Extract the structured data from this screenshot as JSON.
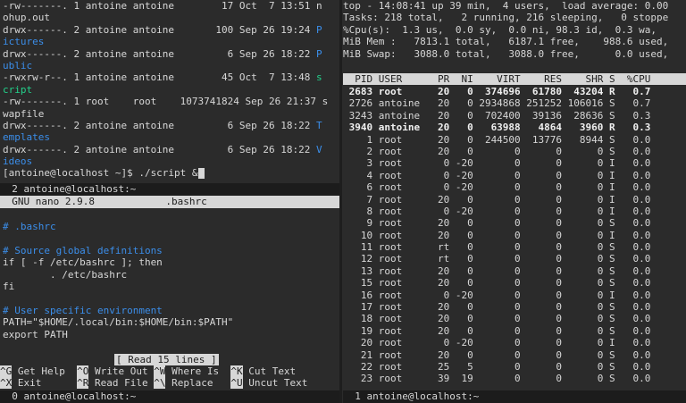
{
  "left_top_terminal": {
    "lines": [
      {
        "text": "-rw-------. 1 antoine antoine        17 Oct  7 13:51 ",
        "tail": "n",
        "tail_color": "dim"
      },
      {
        "text": "ohup.out",
        "tail": "",
        "tail_color": "dim"
      },
      {
        "text": "drwx------. 2 antoine antoine       100 Sep 26 19:24 ",
        "tail": "P",
        "tail_color": "blue"
      },
      {
        "text": "",
        "tail": "ictures",
        "tail_color": "blue"
      },
      {
        "text": "drwx------. 2 antoine antoine         6 Sep 26 18:22 ",
        "tail": "P",
        "tail_color": "blue"
      },
      {
        "text": "",
        "tail": "ublic",
        "tail_color": "blue"
      },
      {
        "text": "-rwxrw-r--. 1 antoine antoine        45 Oct  7 13:48 ",
        "tail": "s",
        "tail_color": "green"
      },
      {
        "text": "",
        "tail": "cript",
        "tail_color": "green"
      },
      {
        "text": "-rw-------. 1 root    root    1073741824 Sep 26 21:37 ",
        "tail": "s",
        "tail_color": "dim"
      },
      {
        "text": "wapfile",
        "tail": "",
        "tail_color": "dim"
      },
      {
        "text": "drwx------. 2 antoine antoine         6 Sep 26 18:22 ",
        "tail": "T",
        "tail_color": "blue"
      },
      {
        "text": "",
        "tail": "emplates",
        "tail_color": "blue"
      },
      {
        "text": "drwx------. 2 antoine antoine         6 Sep 26 18:22 ",
        "tail": "V",
        "tail_color": "blue"
      },
      {
        "text": "",
        "tail": "ideos",
        "tail_color": "blue"
      },
      {
        "text": "[antoine@localhost ~]$ ./script &",
        "tail": "",
        "tail_color": "dim"
      }
    ],
    "status": "  2 antoine@localhost:~"
  },
  "nano": {
    "title": "  GNU nano 2.9.8            .bashrc",
    "lines": [
      {
        "text": "# .bashrc",
        "color": "cmt"
      },
      {
        "text": "",
        "color": "dim"
      },
      {
        "text": "# Source global definitions",
        "color": "cmt"
      },
      {
        "text": "if [ -f /etc/bashrc ]; then",
        "color": "dim"
      },
      {
        "text": "        . /etc/bashrc",
        "color": "dim"
      },
      {
        "text": "fi",
        "color": "dim"
      },
      {
        "text": "",
        "color": "dim"
      },
      {
        "text": "# User specific environment",
        "color": "cmt"
      },
      {
        "text": "PATH=\"$HOME/.local/bin:$HOME/bin:$PATH\"",
        "color": "dim"
      },
      {
        "text": "export PATH",
        "color": "dim"
      }
    ],
    "message": "[ Read 15 lines ]",
    "shortcuts_row1": [
      {
        "key": "^G",
        "label": " Get Help  "
      },
      {
        "key": "^O",
        "label": " Write Out "
      },
      {
        "key": "^W",
        "label": " Where Is  "
      },
      {
        "key": "^K",
        "label": " Cut Text"
      }
    ],
    "shortcuts_row2": [
      {
        "key": "^X",
        "label": " Exit      "
      },
      {
        "key": "^R",
        "label": " Read File "
      },
      {
        "key": "^\\",
        "label": " Replace   "
      },
      {
        "key": "^U",
        "label": " Uncut Text"
      }
    ],
    "status": "  0 antoine@localhost:~"
  },
  "top": {
    "summary": [
      "top - 14:08:41 up 39 min,  4 users,  load average: 0.00",
      "Tasks: 218 total,   2 running, 216 sleeping,   0 stoppe",
      "%Cpu(s):  1.3 us,  0.0 sy,  0.0 ni, 98.3 id,  0.3 wa,",
      "MiB Mem :   7813.1 total,   6187.1 free,    988.6 used,",
      "MiB Swap:   3088.0 total,   3088.0 free,      0.0 used,"
    ],
    "header": "  PID USER      PR  NI    VIRT    RES    SHR S  %CPU",
    "rows": [
      {
        "text": " 2683 root      20   0  374696  61780  43204 R   0.7",
        "bold": true
      },
      {
        "text": " 2726 antoine   20   0 2934868 251252 106016 S   0.7",
        "bold": false
      },
      {
        "text": " 3243 antoine   20   0  702400  39136  28636 S   0.3",
        "bold": false
      },
      {
        "text": " 3940 antoine   20   0   63988   4864   3960 R   0.3",
        "bold": true
      },
      {
        "text": "    1 root      20   0  244500  13776   8944 S   0.0",
        "bold": false
      },
      {
        "text": "    2 root      20   0       0      0      0 S   0.0",
        "bold": false
      },
      {
        "text": "    3 root       0 -20       0      0      0 I   0.0",
        "bold": false
      },
      {
        "text": "    4 root       0 -20       0      0      0 I   0.0",
        "bold": false
      },
      {
        "text": "    6 root       0 -20       0      0      0 I   0.0",
        "bold": false
      },
      {
        "text": "    7 root      20   0       0      0      0 I   0.0",
        "bold": false
      },
      {
        "text": "    8 root       0 -20       0      0      0 I   0.0",
        "bold": false
      },
      {
        "text": "    9 root      20   0       0      0      0 S   0.0",
        "bold": false
      },
      {
        "text": "   10 root      20   0       0      0      0 I   0.0",
        "bold": false
      },
      {
        "text": "   11 root      rt   0       0      0      0 S   0.0",
        "bold": false
      },
      {
        "text": "   12 root      rt   0       0      0      0 S   0.0",
        "bold": false
      },
      {
        "text": "   13 root      20   0       0      0      0 S   0.0",
        "bold": false
      },
      {
        "text": "   15 root      20   0       0      0      0 S   0.0",
        "bold": false
      },
      {
        "text": "   16 root       0 -20       0      0      0 I   0.0",
        "bold": false
      },
      {
        "text": "   17 root      20   0       0      0      0 S   0.0",
        "bold": false
      },
      {
        "text": "   18 root      20   0       0      0      0 S   0.0",
        "bold": false
      },
      {
        "text": "   19 root      20   0       0      0      0 S   0.0",
        "bold": false
      },
      {
        "text": "   20 root       0 -20       0      0      0 I   0.0",
        "bold": false
      },
      {
        "text": "   21 root      20   0       0      0      0 S   0.0",
        "bold": false
      },
      {
        "text": "   22 root      25   5       0      0      0 S   0.0",
        "bold": false
      },
      {
        "text": "   23 root      39  19       0      0      0 S   0.0",
        "bold": false
      }
    ],
    "status": "  1 antoine@localhost:~"
  }
}
